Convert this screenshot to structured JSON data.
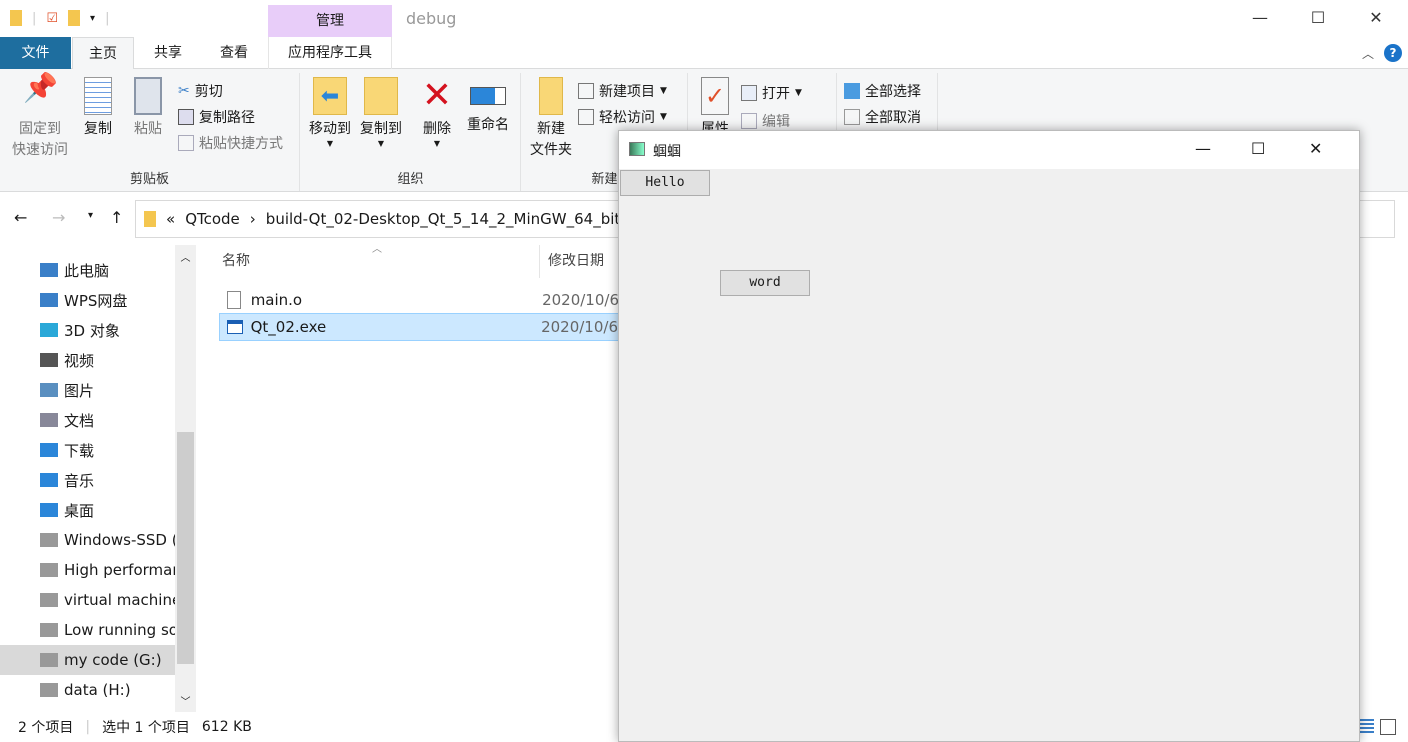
{
  "window": {
    "context_tab": "管理",
    "title": "debug",
    "minimize": "—",
    "maximize": "☐",
    "close": "✕"
  },
  "tabs": {
    "file": "文件",
    "home": "主页",
    "share": "共享",
    "view": "查看",
    "app_tools": "应用程序工具"
  },
  "ribbon": {
    "clipboard": {
      "label": "剪贴板",
      "pin": "固定到\n快速访问",
      "copy": "复制",
      "paste": "粘贴",
      "cut": "剪切",
      "copy_path": "复制路径",
      "paste_shortcut": "粘贴快捷方式"
    },
    "organize": {
      "label": "组织",
      "move_to": "移动到",
      "copy_to": "复制到",
      "delete": "删除",
      "rename": "重命名"
    },
    "new": {
      "label": "新建",
      "new_folder": "新建\n文件夹",
      "new_item": "新建项目",
      "easy_access": "轻松访问"
    },
    "open": {
      "properties": "属性",
      "open": "打开",
      "edit": "编辑"
    },
    "select": {
      "select_all": "全部选择",
      "select_none": "全部取消"
    }
  },
  "address": {
    "overflow": "«",
    "crumbs": [
      "QTcode",
      "build-Qt_02-Desktop_Qt_5_14_2_MinGW_64_bit-"
    ]
  },
  "nav": {
    "items": [
      {
        "label": "此电脑",
        "icon": "pc-icon"
      },
      {
        "label": "WPS网盘",
        "icon": "cloud-icon"
      },
      {
        "label": "3D 对象",
        "icon": "cube-icon"
      },
      {
        "label": "视频",
        "icon": "video-icon"
      },
      {
        "label": "图片",
        "icon": "picture-icon"
      },
      {
        "label": "文档",
        "icon": "document-icon"
      },
      {
        "label": "下载",
        "icon": "download-icon"
      },
      {
        "label": "音乐",
        "icon": "music-icon"
      },
      {
        "label": "桌面",
        "icon": "desktop-icon"
      },
      {
        "label": "Windows-SSD (C:)",
        "icon": "drive-icon"
      },
      {
        "label": "High performance",
        "icon": "drive-icon"
      },
      {
        "label": "virtual machine",
        "icon": "drive-icon"
      },
      {
        "label": "Low running soft",
        "icon": "drive-icon"
      },
      {
        "label": "my code (G:)",
        "icon": "drive-icon"
      },
      {
        "label": "data (H:)",
        "icon": "drive-icon"
      }
    ]
  },
  "files": {
    "col_name": "名称",
    "col_date": "修改日期",
    "rows": [
      {
        "name": "main.o",
        "date": "2020/10/6"
      },
      {
        "name": "Qt_02.exe",
        "date": "2020/10/6"
      }
    ]
  },
  "status": {
    "count": "2 个项目",
    "selected": "选中 1 个项目",
    "size": "612 KB"
  },
  "qt": {
    "title": "蝈蝈",
    "hello": "Hello",
    "word": "word"
  }
}
